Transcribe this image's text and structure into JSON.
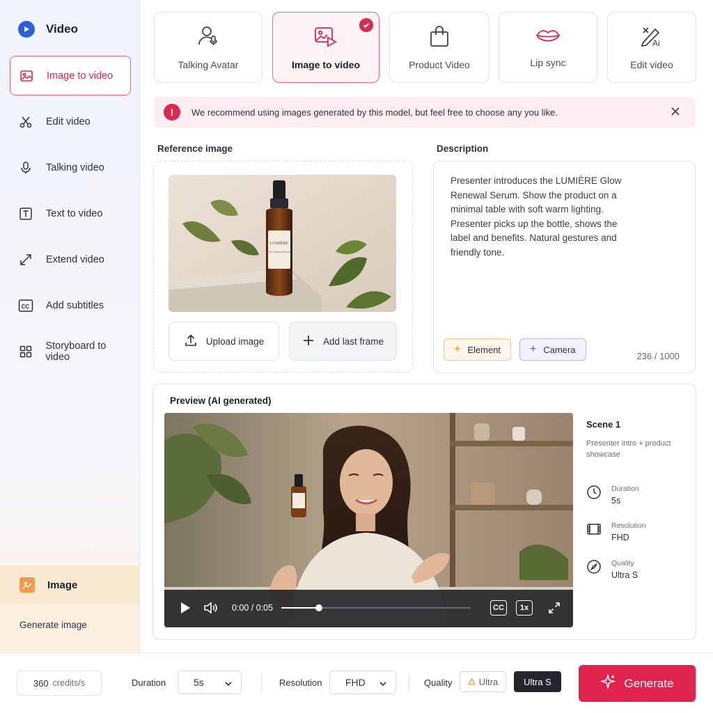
{
  "sidebar": {
    "brand": "Video",
    "items": [
      {
        "label": "Image to video",
        "icon": "image-icon"
      },
      {
        "label": "Edit video",
        "icon": "scissors-icon"
      },
      {
        "label": "Talking video",
        "icon": "microphone-icon"
      },
      {
        "label": "Text to video",
        "icon": "text-box-icon"
      },
      {
        "label": "Extend video",
        "icon": "expand-arrows-icon"
      },
      {
        "label": "Add subtitles",
        "icon": "cc-icon"
      },
      {
        "label": "Storyboard to video",
        "icon": "grid-icon"
      }
    ],
    "image_section": {
      "title": "Image",
      "item": "Generate image"
    }
  },
  "modes": [
    {
      "label": "Talking Avatar",
      "icon": "avatar-mic-icon"
    },
    {
      "label": "Image to video",
      "icon": "image-video-icon",
      "selected": true
    },
    {
      "label": "Product Video",
      "icon": "shopping-bag-icon"
    },
    {
      "label": "Lip sync",
      "icon": "lips-icon"
    },
    {
      "label": "Edit video",
      "icon": "ai-edit-icon"
    }
  ],
  "alert": {
    "text": "We recommend using images generated by this model, but feel free to choose any you like."
  },
  "reference": {
    "label": "Reference image",
    "upload_label": "Upload image",
    "last_frame_label": "Add last frame",
    "bottle_brand": "LUMIÈRE",
    "bottle_sub": "Glow Renewal Serum"
  },
  "description": {
    "label": "Description",
    "text": "Presenter introduces the LUMIÈRE Glow Renewal Serum. Show the product on a minimal table with soft warm lighting. Presenter picks up the bottle, shows the label and benefits. Natural gestures and friendly tone.",
    "element_label": "Element",
    "camera_label": "Camera",
    "counter": "236 / 1000"
  },
  "preview": {
    "title": "Preview (AI generated)",
    "time": "0:00 / 0:05",
    "progress": 0.2,
    "cc_label": "CC",
    "speed_label": "1x",
    "scene_title": "Scene 1",
    "scene_desc": "Presenter intro + product showcase",
    "meta": [
      {
        "label": "Duration",
        "value": "5s",
        "icon": "clock-icon"
      },
      {
        "label": "Resolution",
        "value": "FHD",
        "icon": "film-icon"
      },
      {
        "label": "Quality",
        "value": "Ultra S",
        "icon": "compass-icon"
      }
    ]
  },
  "bottom": {
    "credits_value": "360",
    "credits_unit": "credits/s",
    "duration_label": "Duration",
    "duration_value": "5s",
    "resolution_label": "Resolution",
    "resolution_value": "FHD",
    "quality_label": "Quality",
    "quality_option_1": "Ultra",
    "quality_option_2": "Ultra S",
    "generate_label": "Generate"
  },
  "colors": {
    "accent": "#e0244f",
    "brand_blue": "#2e5fd8"
  }
}
